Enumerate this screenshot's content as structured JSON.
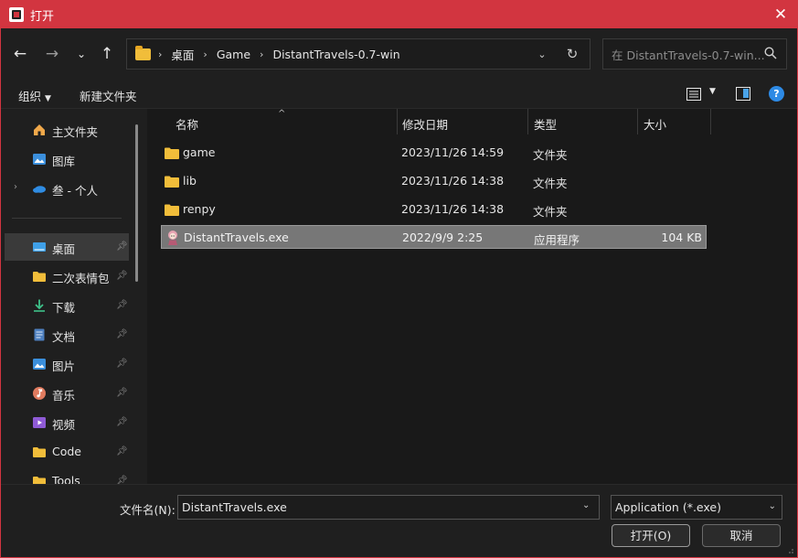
{
  "window": {
    "title": "打开",
    "accent": "#d23540"
  },
  "nav": {
    "breadcrumbs": [
      "桌面",
      "Game",
      "DistantTravels-0.7-win"
    ],
    "search_placeholder": "在 DistantTravels-0.7-win..."
  },
  "toolbar": {
    "organize_label": "组织",
    "new_folder_label": "新建文件夹"
  },
  "sidebar": {
    "items": [
      {
        "label": "主文件夹",
        "icon": "home-icon"
      },
      {
        "label": "图库",
        "icon": "gallery-icon"
      },
      {
        "label": "叁 - 个人",
        "icon": "onedrive-icon"
      },
      {
        "label": "桌面",
        "icon": "desktop-icon",
        "pinned": true,
        "selected": true
      },
      {
        "label": "二次表情包",
        "icon": "folder-icon",
        "pinned": true
      },
      {
        "label": "下载",
        "icon": "download-icon",
        "pinned": true
      },
      {
        "label": "文档",
        "icon": "documents-icon",
        "pinned": true
      },
      {
        "label": "图片",
        "icon": "pictures-icon",
        "pinned": true
      },
      {
        "label": "音乐",
        "icon": "music-icon",
        "pinned": true
      },
      {
        "label": "视频",
        "icon": "videos-icon",
        "pinned": true
      },
      {
        "label": "Code",
        "icon": "folder-icon",
        "pinned": true
      },
      {
        "label": "Tools",
        "icon": "folder-icon",
        "pinned": true
      }
    ]
  },
  "filelist": {
    "columns": {
      "name": "名称",
      "date": "修改日期",
      "type": "类型",
      "size": "大小"
    },
    "rows": [
      {
        "name": "game",
        "date": "2023/11/26 14:59",
        "type": "文件夹",
        "size": "",
        "icon": "folder-icon"
      },
      {
        "name": "lib",
        "date": "2023/11/26 14:38",
        "type": "文件夹",
        "size": "",
        "icon": "folder-icon"
      },
      {
        "name": "renpy",
        "date": "2023/11/26 14:38",
        "type": "文件夹",
        "size": "",
        "icon": "folder-icon"
      },
      {
        "name": "DistantTravels.exe",
        "date": "2022/9/9 2:25",
        "type": "应用程序",
        "size": "104 KB",
        "icon": "app-exe-icon",
        "selected": true
      }
    ]
  },
  "bottom": {
    "filename_label": "文件名(N):",
    "filename_value": "DistantTravels.exe",
    "filter_value": "Application (*.exe)",
    "open_label": "打开(O)",
    "cancel_label": "取消"
  }
}
